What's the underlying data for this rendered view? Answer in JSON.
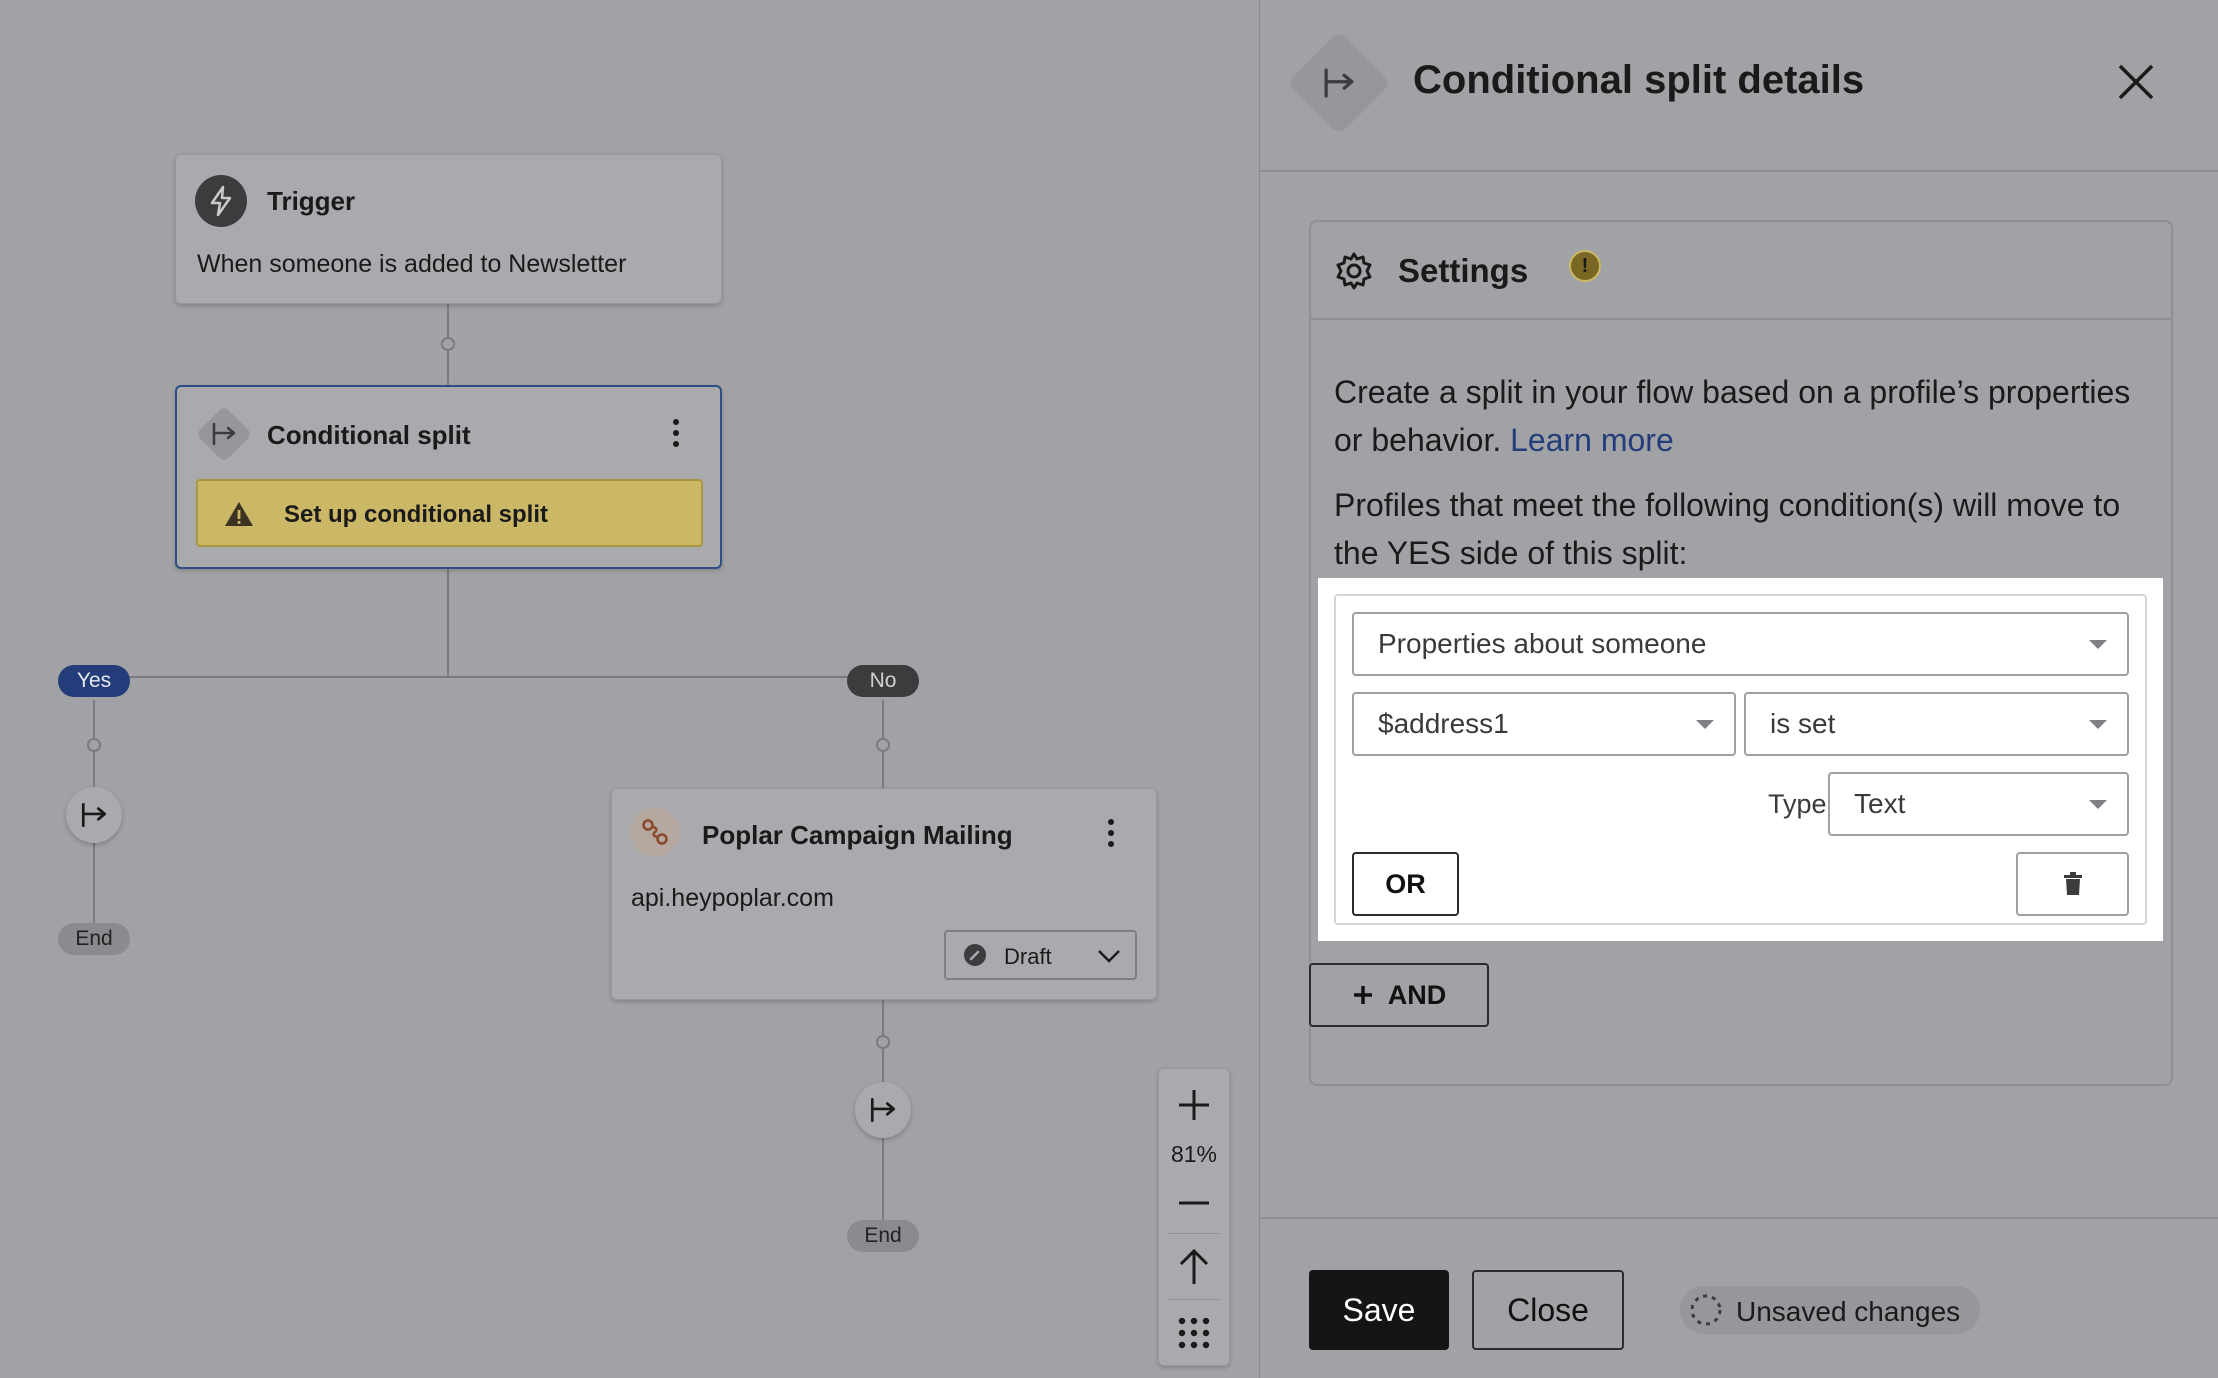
{
  "canvas": {
    "trigger": {
      "title": "Trigger",
      "description": "When someone is added to Newsletter"
    },
    "split": {
      "title": "Conditional split",
      "warning": "Set up conditional split"
    },
    "branches": {
      "yes": "Yes",
      "no": "No",
      "end": "End"
    },
    "webhook": {
      "title": "Poplar Campaign Mailing",
      "url": "api.heypoplar.com",
      "status": "Draft"
    },
    "zoom": {
      "level": "81%"
    }
  },
  "panel": {
    "title": "Conditional split details",
    "settings": {
      "heading": "Settings",
      "description": "Create a split in your flow based on a profile’s properties or behavior.",
      "learn_more": "Learn more",
      "condition_intro": "Profiles that meet the following condition(s) will move to the YES side of this split:"
    },
    "condition": {
      "group": "Properties about someone",
      "property": "$address1",
      "operator": "is set",
      "type_label": "Type:",
      "type_value": "Text",
      "or_label": "OR"
    },
    "and_label": "AND",
    "footer": {
      "save": "Save",
      "close": "Close",
      "unsaved": "Unsaved changes"
    }
  },
  "colors": {
    "canvas_bg": "#a1a2a5",
    "warning_bg": "#cbb866",
    "yes_pill": "#243d7a",
    "no_pill": "#3b3c3e",
    "save_bg": "#151515",
    "link": "#243d7a"
  }
}
